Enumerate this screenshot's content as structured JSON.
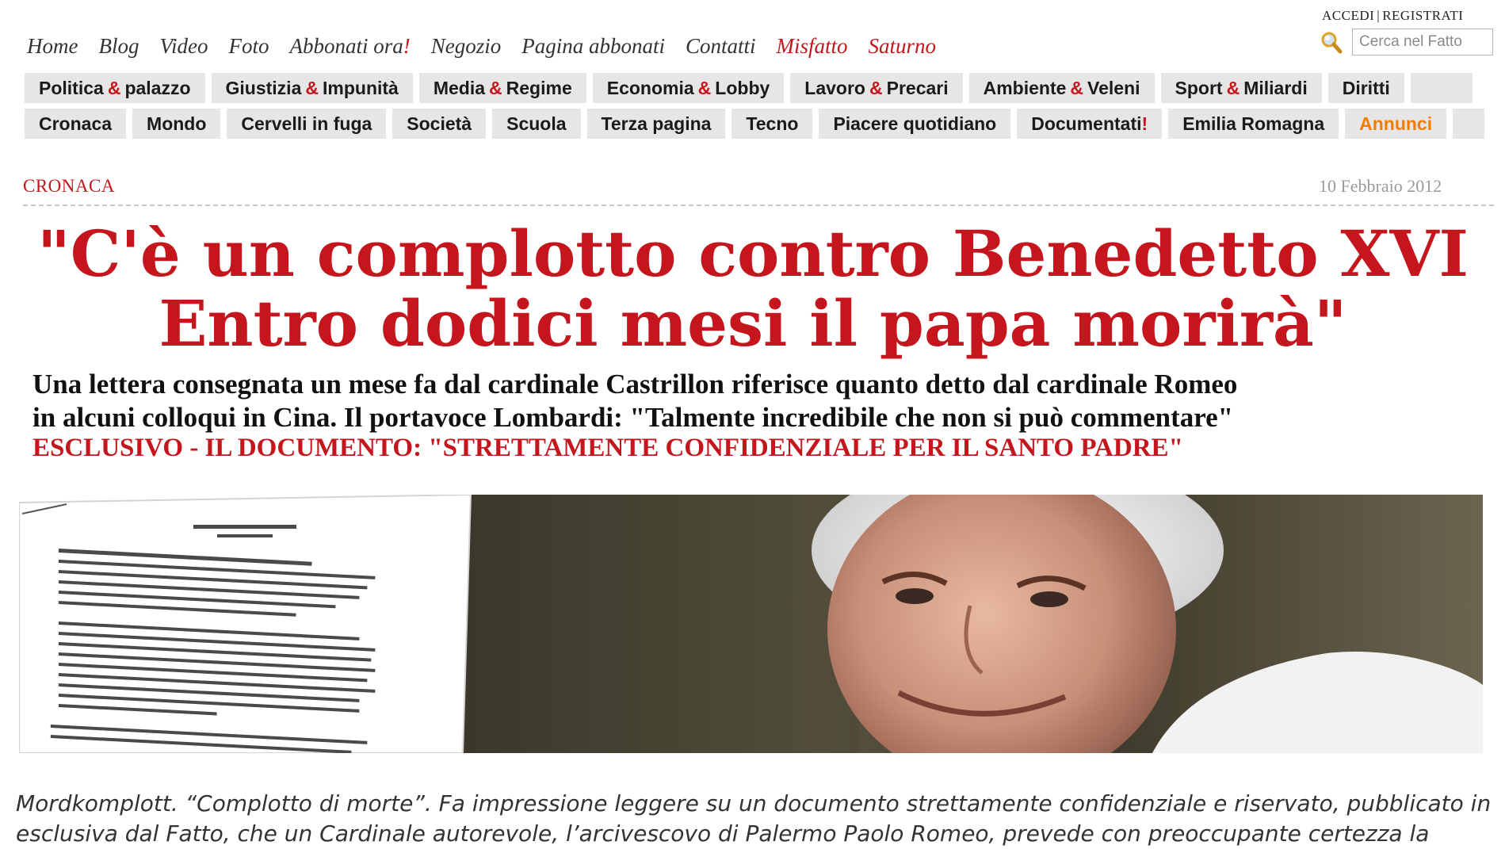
{
  "account": {
    "login": "ACCEDI",
    "separator": "|",
    "register": "REGISTRATI"
  },
  "topnav": {
    "items": [
      {
        "label": "Home"
      },
      {
        "label": "Blog"
      },
      {
        "label": "Video"
      },
      {
        "label": "Foto"
      },
      {
        "label": "Abbonati ora",
        "suffix": "!"
      },
      {
        "label": "Negozio"
      },
      {
        "label": "Pagina abbonati"
      },
      {
        "label": "Contatti"
      },
      {
        "label": "Misfatto"
      },
      {
        "label": "Saturno"
      }
    ],
    "highlight_color": "#c4161c"
  },
  "search": {
    "placeholder": "Cerca nel Fatto",
    "icon": "magnifier-icon"
  },
  "sections_row1": [
    {
      "a": "Politica",
      "b": "palazzo"
    },
    {
      "a": "Giustizia",
      "b": "Impunità"
    },
    {
      "a": "Media",
      "b": "Regime"
    },
    {
      "a": "Economia",
      "b": "Lobby"
    },
    {
      "a": "Lavoro",
      "b": "Precari"
    },
    {
      "a": "Ambiente",
      "b": "Veleni"
    },
    {
      "a": "Sport",
      "b": "Miliardi"
    },
    {
      "a": "Diritti"
    }
  ],
  "sections_row2": [
    {
      "label": "Cronaca"
    },
    {
      "label": "Mondo"
    },
    {
      "label": "Cervelli in fuga"
    },
    {
      "label": "Società"
    },
    {
      "label": "Scuola"
    },
    {
      "label": "Terza pagina"
    },
    {
      "label": "Tecno"
    },
    {
      "label": "Piacere quotidiano"
    },
    {
      "label": "Documentati",
      "suffix": "!"
    },
    {
      "label": "Emilia Romagna"
    },
    {
      "label": "Annunci"
    }
  ],
  "article": {
    "category": "CRONACA",
    "date": "10 Febbraio 2012",
    "headline_line1": "\"C'è un complotto contro Benedetto XVI",
    "headline_line2": "Entro dodici mesi il papa morirà\"",
    "subhead_line1": "Una lettera consegnata un mese fa dal cardinale Castrillon riferisce quanto detto dal cardinale Romeo",
    "subhead_line2": "in alcuni colloqui in Cina. Il portavoce Lombardi: \"Talmente incredibile che non si può commentare\"",
    "exclusive": "ESCLUSIVO - IL DOCUMENTO:  \"STRETTAMENTE CONFIDENZIALE PER IL SANTO PADRE\"",
    "lead_line1": "Mordkomplott. “Complotto di morte”. Fa impressione leggere su un documento strettamente confidenziale e riservato, pubblicato in",
    "lead_line2": "esclusiva dal Fatto, che un Cardinale autorevole, l’arcivescovo di Palermo Paolo Romeo, prevede con preoccupante certezza la"
  },
  "colors": {
    "brand_red": "#c4161c",
    "tab_bg": "#e6e6e6",
    "annunci_orange": "#f07d00"
  }
}
